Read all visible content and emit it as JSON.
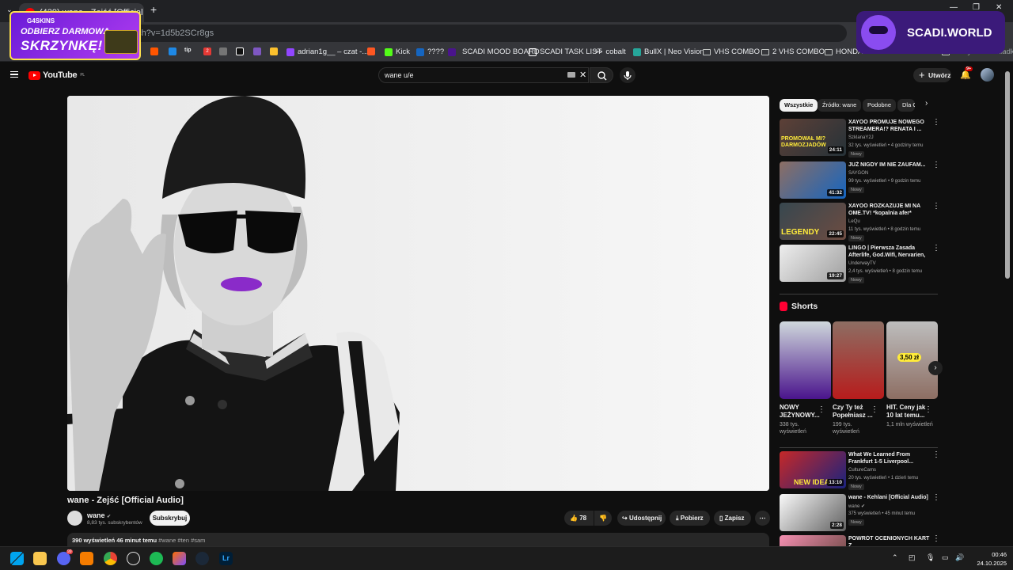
{
  "browser": {
    "tab_title": "(429) wane - Zejść [Official",
    "url": "atch?v=1d5b2SCr8gs",
    "bookmarks": [
      "adrian1g__ – czat -...",
      "Kick",
      "????",
      "SCADI MOOD BOARD",
      "SCADI TASK LIST",
      "cobalt",
      "BullX | Neo Vision",
      "VHS COMBO",
      "2 VHS COMBO",
      "HONDA",
      "Wszystkie zakładki"
    ],
    "bookmark_badge": "2"
  },
  "overlays": {
    "promo_brand": "G4SKINS",
    "promo_line1": "ODBIERZ DARMOWĄ",
    "promo_line2": "SKRZYNKĘ!",
    "scadi_text": "SCADI.WORLD"
  },
  "youtube": {
    "logo": "YouTube",
    "logo_region": "PL",
    "search_value": "wane u/e",
    "create_label": "Utwórz",
    "notifications_badge": "9+"
  },
  "video": {
    "title": "wane - Zejść [Official Audio]",
    "channel": "wane",
    "subscribers": "8,83 tys. subskrybentów",
    "subscribe_label": "Subskrybuj",
    "likes": "78",
    "share_label": "Udostępnij",
    "download_label": "Pobierz",
    "save_label": "Zapisz",
    "views_time": "390 wyświetleń  46 minut temu",
    "hashtags": "#wane #ten #sam"
  },
  "sidebar": {
    "chips": [
      "Wszystkie",
      "Źródło: wane",
      "Podobne",
      "Dla Ci"
    ],
    "recs_top": [
      {
        "title": "XAYOO PROMUJE NOWEGO STREAMERA!? RENATA I ...",
        "channel": "SzklanaY2J",
        "meta": "32 tys. wyświetleń • 4 godziny temu",
        "badge": "Nowy",
        "duration": "24:11",
        "thumb_text": "PROMOWAŁ MI? DARMOZJADÓW"
      },
      {
        "title": "JUŻ NIGDY IM NIE ZAUFAM...",
        "channel": "SAYGON",
        "meta": "99 tys. wyświetleń • 9 godzin temu",
        "badge": "Nowy",
        "duration": "41:32",
        "thumb_text": ""
      },
      {
        "title": "XAYOO ROZKAZUJE MI NA OME.TV! *kopalnia afer*",
        "channel": "LeQu",
        "meta": "11 tys. wyświetleń • 8 godzin temu",
        "badge": "Nowy",
        "duration": "22:45",
        "thumb_text": "LEGENDY"
      },
      {
        "title": "LINGO | Pierwsza Zasada Afterlife, God.Wifi, Nervarien, ...",
        "channel": "UnderwayTV",
        "meta": "2,4 tys. wyświetleń • 8 godzin temu",
        "badge": "Nowy",
        "duration": "19:27",
        "thumb_text": ""
      }
    ],
    "shorts_label": "Shorts",
    "shorts": [
      {
        "title": "NOWY JEŻYNOWY...",
        "views": "338 tys. wyświetleń"
      },
      {
        "title": "Czy Ty też Popełniasz ...",
        "views": "199 tys. wyświetleń"
      },
      {
        "title": "HIT. Ceny jak 10 lat temu...",
        "views": "1,1 mln wyświetleń",
        "thumb_text": "3,50 zł"
      }
    ],
    "recs_bottom": [
      {
        "title": "What We Learned From Frankfurt 1-5 Liverpool...",
        "channel": "CultureCams",
        "meta": "20 tys. wyświetleń • 1 dzień temu",
        "badge": "Nowy",
        "duration": "13:10",
        "thumb_text": "NEW IDEA"
      },
      {
        "title": "wane - Kehlani [Official Audio]",
        "channel": "wane",
        "meta": "375 wyświetleń • 45 minut temu",
        "badge": "Nowy",
        "duration": "2:28",
        "thumb_text": ""
      },
      {
        "title": "POWRÓT OCENIONYCH KART Z",
        "channel": "",
        "meta": "",
        "badge": "",
        "duration": "",
        "thumb_text": ""
      }
    ]
  },
  "taskbar": {
    "time": "00:46",
    "date": "24.10.2025",
    "discord_badge": "99"
  },
  "colors": {
    "yt_red": "#ff0000",
    "bg": "#0f0f0f",
    "surface": "#272727"
  }
}
